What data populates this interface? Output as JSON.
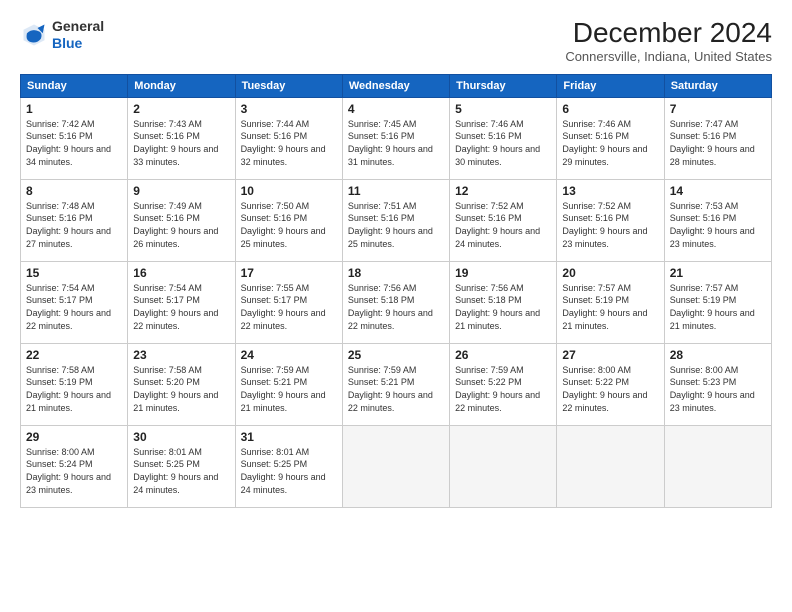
{
  "header": {
    "logo": {
      "line1": "General",
      "line2": "Blue"
    },
    "title": "December 2024",
    "subtitle": "Connersville, Indiana, United States"
  },
  "calendar": {
    "days_of_week": [
      "Sunday",
      "Monday",
      "Tuesday",
      "Wednesday",
      "Thursday",
      "Friday",
      "Saturday"
    ],
    "weeks": [
      [
        {
          "day": "",
          "empty": true
        },
        {
          "day": "",
          "empty": true
        },
        {
          "day": "",
          "empty": true
        },
        {
          "day": "",
          "empty": true
        },
        {
          "day": "",
          "empty": true
        },
        {
          "day": "",
          "empty": true
        },
        {
          "day": "",
          "empty": true
        }
      ]
    ],
    "cells": [
      {
        "date": "1",
        "sunrise": "7:42 AM",
        "sunset": "5:16 PM",
        "daylight": "9 hours and 34 minutes."
      },
      {
        "date": "2",
        "sunrise": "7:43 AM",
        "sunset": "5:16 PM",
        "daylight": "9 hours and 33 minutes."
      },
      {
        "date": "3",
        "sunrise": "7:44 AM",
        "sunset": "5:16 PM",
        "daylight": "9 hours and 32 minutes."
      },
      {
        "date": "4",
        "sunrise": "7:45 AM",
        "sunset": "5:16 PM",
        "daylight": "9 hours and 31 minutes."
      },
      {
        "date": "5",
        "sunrise": "7:46 AM",
        "sunset": "5:16 PM",
        "daylight": "9 hours and 30 minutes."
      },
      {
        "date": "6",
        "sunrise": "7:46 AM",
        "sunset": "5:16 PM",
        "daylight": "9 hours and 29 minutes."
      },
      {
        "date": "7",
        "sunrise": "7:47 AM",
        "sunset": "5:16 PM",
        "daylight": "9 hours and 28 minutes."
      },
      {
        "date": "8",
        "sunrise": "7:48 AM",
        "sunset": "5:16 PM",
        "daylight": "9 hours and 27 minutes."
      },
      {
        "date": "9",
        "sunrise": "7:49 AM",
        "sunset": "5:16 PM",
        "daylight": "9 hours and 26 minutes."
      },
      {
        "date": "10",
        "sunrise": "7:50 AM",
        "sunset": "5:16 PM",
        "daylight": "9 hours and 25 minutes."
      },
      {
        "date": "11",
        "sunrise": "7:51 AM",
        "sunset": "5:16 PM",
        "daylight": "9 hours and 25 minutes."
      },
      {
        "date": "12",
        "sunrise": "7:52 AM",
        "sunset": "5:16 PM",
        "daylight": "9 hours and 24 minutes."
      },
      {
        "date": "13",
        "sunrise": "7:52 AM",
        "sunset": "5:16 PM",
        "daylight": "9 hours and 23 minutes."
      },
      {
        "date": "14",
        "sunrise": "7:53 AM",
        "sunset": "5:16 PM",
        "daylight": "9 hours and 23 minutes."
      },
      {
        "date": "15",
        "sunrise": "7:54 AM",
        "sunset": "5:17 PM",
        "daylight": "9 hours and 22 minutes."
      },
      {
        "date": "16",
        "sunrise": "7:54 AM",
        "sunset": "5:17 PM",
        "daylight": "9 hours and 22 minutes."
      },
      {
        "date": "17",
        "sunrise": "7:55 AM",
        "sunset": "5:17 PM",
        "daylight": "9 hours and 22 minutes."
      },
      {
        "date": "18",
        "sunrise": "7:56 AM",
        "sunset": "5:18 PM",
        "daylight": "9 hours and 22 minutes."
      },
      {
        "date": "19",
        "sunrise": "7:56 AM",
        "sunset": "5:18 PM",
        "daylight": "9 hours and 21 minutes."
      },
      {
        "date": "20",
        "sunrise": "7:57 AM",
        "sunset": "5:19 PM",
        "daylight": "9 hours and 21 minutes."
      },
      {
        "date": "21",
        "sunrise": "7:57 AM",
        "sunset": "5:19 PM",
        "daylight": "9 hours and 21 minutes."
      },
      {
        "date": "22",
        "sunrise": "7:58 AM",
        "sunset": "5:19 PM",
        "daylight": "9 hours and 21 minutes."
      },
      {
        "date": "23",
        "sunrise": "7:58 AM",
        "sunset": "5:20 PM",
        "daylight": "9 hours and 21 minutes."
      },
      {
        "date": "24",
        "sunrise": "7:59 AM",
        "sunset": "5:21 PM",
        "daylight": "9 hours and 21 minutes."
      },
      {
        "date": "25",
        "sunrise": "7:59 AM",
        "sunset": "5:21 PM",
        "daylight": "9 hours and 22 minutes."
      },
      {
        "date": "26",
        "sunrise": "7:59 AM",
        "sunset": "5:22 PM",
        "daylight": "9 hours and 22 minutes."
      },
      {
        "date": "27",
        "sunrise": "8:00 AM",
        "sunset": "5:22 PM",
        "daylight": "9 hours and 22 minutes."
      },
      {
        "date": "28",
        "sunrise": "8:00 AM",
        "sunset": "5:23 PM",
        "daylight": "9 hours and 23 minutes."
      },
      {
        "date": "29",
        "sunrise": "8:00 AM",
        "sunset": "5:24 PM",
        "daylight": "9 hours and 23 minutes."
      },
      {
        "date": "30",
        "sunrise": "8:01 AM",
        "sunset": "5:25 PM",
        "daylight": "9 hours and 24 minutes."
      },
      {
        "date": "31",
        "sunrise": "8:01 AM",
        "sunset": "5:25 PM",
        "daylight": "9 hours and 24 minutes."
      }
    ],
    "start_day_of_week": 0,
    "days_in_month": 31
  }
}
